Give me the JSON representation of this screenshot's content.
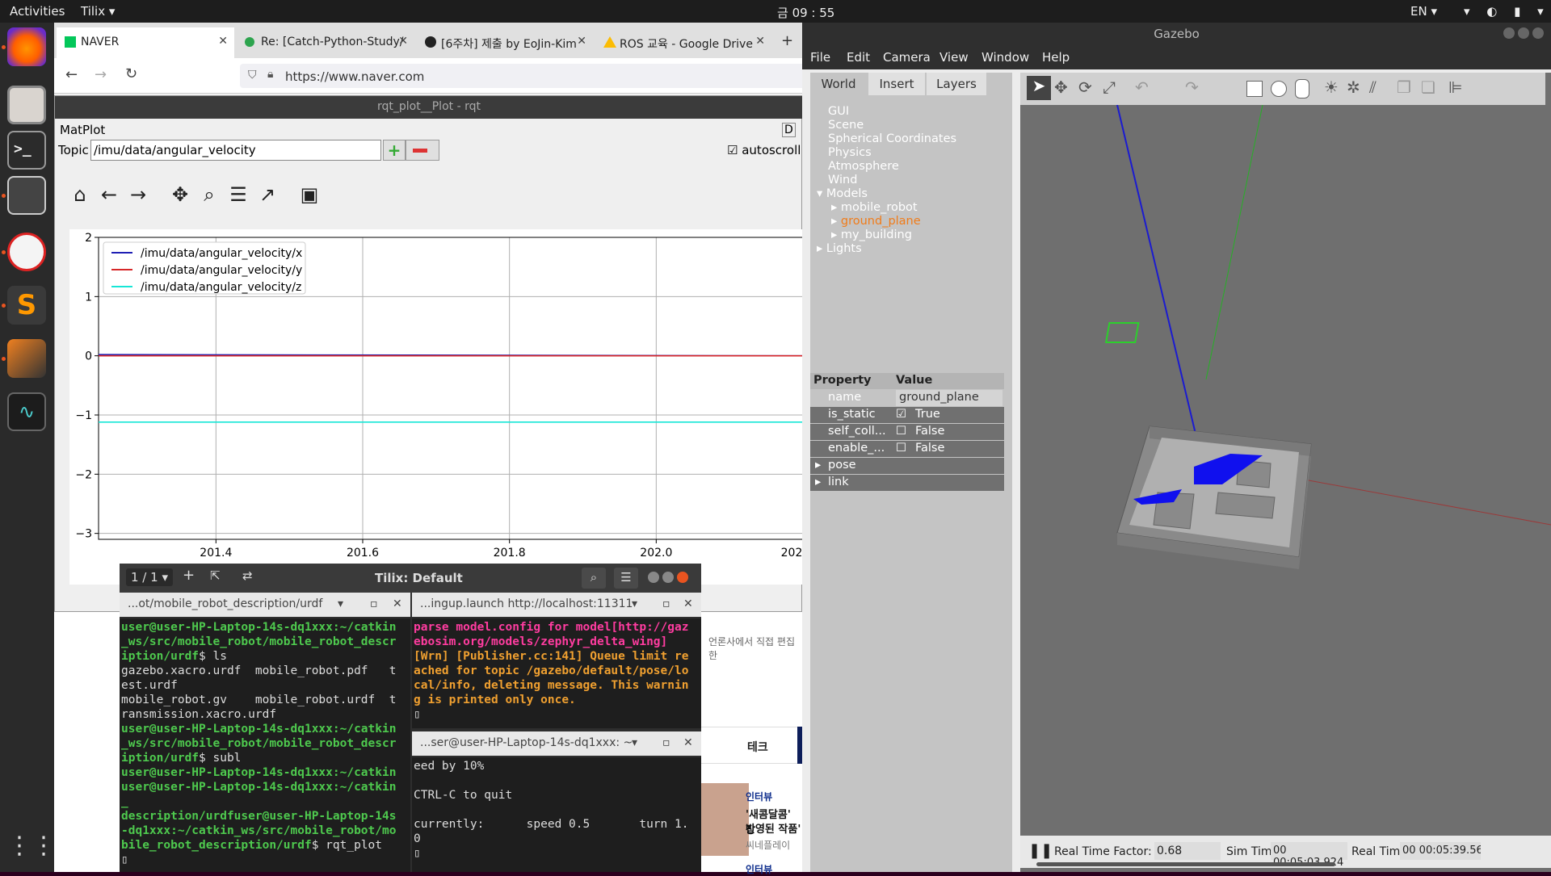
{
  "topbar": {
    "activities": "Activities",
    "app_name": "Tilix ▾",
    "clock": "금 09 : 55",
    "lang": "EN ▾",
    "sys_icons": "▾ ◐ ▮ ▾"
  },
  "browser": {
    "tabs": [
      {
        "label": "NAVER"
      },
      {
        "label": "Re: [Catch-Python-Study/"
      },
      {
        "label": "[6주차] 제출 by EoJin-Kim"
      },
      {
        "label": "ROS 교육 - Google Drive"
      }
    ],
    "url": "https://www.naver.com",
    "bg_texts": {
      "korean_line": "언론사에서 직접 편집한",
      "tech": "테크",
      "interview1": "인터뷰",
      "headline1": "'새콤달콤' 장",
      "headline2": "반영된 작품'",
      "source": "씨네플레이",
      "interview2": "인터뷰"
    }
  },
  "rqt": {
    "window_title": "rqt_plot__Plot - rqt",
    "panel_title": "MatPlot",
    "panel_badge": "D",
    "topic_label": "Topic",
    "topic_value": "/imu/data/angular_velocity",
    "add_symbol": "+",
    "autoscroll_label": "autoscroll",
    "autoscroll_checked": true
  },
  "chart_data": {
    "type": "line",
    "title": "",
    "xlabel": "",
    "ylabel": "",
    "xlim": [
      201.24,
      202.2
    ],
    "ylim": [
      -3.1,
      2
    ],
    "x_ticks": [
      {
        "v": 201.4,
        "label": "201.4"
      },
      {
        "v": 201.6,
        "label": "201.6"
      },
      {
        "v": 201.8,
        "label": "201.8"
      },
      {
        "v": 202.0,
        "label": "202.0"
      },
      {
        "v": 202.2,
        "label": "202"
      }
    ],
    "y_ticks": [
      {
        "v": 2,
        "label": "2"
      },
      {
        "v": 1,
        "label": "1"
      },
      {
        "v": 0,
        "label": "0"
      },
      {
        "v": -1,
        "label": "−1"
      },
      {
        "v": -2,
        "label": "−2"
      },
      {
        "v": -3,
        "label": "−3"
      }
    ],
    "grid": true,
    "legend_position": "top-left",
    "series": [
      {
        "name": "/imu/data/angular_velocity/x",
        "color": "#1f1fb4",
        "x": [
          201.24,
          202.2
        ],
        "values": [
          0.02,
          0.0
        ]
      },
      {
        "name": "/imu/data/angular_velocity/y",
        "color": "#d62728",
        "x": [
          201.24,
          202.2
        ],
        "values": [
          0.0,
          0.0
        ]
      },
      {
        "name": "/imu/data/angular_velocity/z",
        "color": "#17e6d6",
        "x": [
          201.24,
          202.2
        ],
        "values": [
          -1.12,
          -1.12
        ]
      }
    ]
  },
  "tilix": {
    "title": "Tilix: Default",
    "session": "1 / 1 ▾",
    "pane1_title": "...ot/mobile_robot_description/urdf",
    "pane2_title": "...ingup.launch http://localhost:11311",
    "pane3_title": "...ser@user-HP-Laptop-14s-dq1xxx: ~",
    "pane1_lines": [
      {
        "cls": "green",
        "text": "user@user-HP-Laptop-14s-dq1xxx:~/catkin"
      },
      {
        "cls": "green",
        "text": "_ws/src/mobile_robot/mobile_robot_descr"
      },
      {
        "cls": "mix",
        "text": "iption/urdf",
        "rest": "$ ls"
      },
      {
        "cls": "",
        "text": "gazebo.xacro.urdf  mobile_robot.pdf   t"
      },
      {
        "cls": "",
        "text": "est.urdf"
      },
      {
        "cls": "",
        "text": "mobile_robot.gv    mobile_robot.urdf  t"
      },
      {
        "cls": "",
        "text": "ransmission.xacro.urdf"
      },
      {
        "cls": "green",
        "text": "user@user-HP-Laptop-14s-dq1xxx:~/catkin"
      },
      {
        "cls": "green",
        "text": "_ws/src/mobile_robot/mobile_robot_descr"
      },
      {
        "cls": "mix",
        "text": "iption/urdf",
        "rest": "$ subl"
      },
      {
        "cls": "green",
        "text": "user@user-HP-Laptop-14s-dq1xxx:~/catkin"
      },
      {
        "cls": "green",
        "text": "user@user-HP-Laptop-14s-dq1xxx:~/catkin"
      },
      {
        "cls": "green",
        "text": "_"
      },
      {
        "cls": "green",
        "text": "description/urdfuser@user-HP-Laptop-14s"
      },
      {
        "cls": "green",
        "text": "-dq1xxx:~/catkin_ws/src/mobile_robot/mo"
      },
      {
        "cls": "mix",
        "text": "bile_robot_description/urdf",
        "rest": "$ rqt_plot"
      },
      {
        "cls": "",
        "text": "▯"
      }
    ],
    "pane2_lines": [
      {
        "cls": "pink",
        "text": "parse model.config for model[http://gaz"
      },
      {
        "cls": "pink",
        "text": "ebosim.org/models/zephyr_delta_wing]"
      },
      {
        "cls": "orange",
        "text": "[Wrn] [Publisher.cc:141] Queue limit re"
      },
      {
        "cls": "orange",
        "text": "ached for topic /gazebo/default/pose/lo"
      },
      {
        "cls": "orange",
        "text": "cal/info, deleting message. This warnin"
      },
      {
        "cls": "orange",
        "text": "g is printed only once."
      },
      {
        "cls": "",
        "text": "▯"
      }
    ],
    "pane3_lines": [
      {
        "cls": "",
        "text": "eed by 10%"
      },
      {
        "cls": "",
        "text": ""
      },
      {
        "cls": "",
        "text": "CTRL-C to quit"
      },
      {
        "cls": "",
        "text": ""
      },
      {
        "cls": "",
        "text": "currently:      speed 0.5       turn 1."
      },
      {
        "cls": "",
        "text": "0"
      },
      {
        "cls": "",
        "text": "▯"
      }
    ]
  },
  "gazebo": {
    "title": "Gazebo",
    "menu": [
      "File",
      "Edit",
      "Camera",
      "View",
      "Window",
      "Help"
    ],
    "tabs": [
      "World",
      "Insert",
      "Layers"
    ],
    "tree": [
      "GUI",
      "Scene",
      "Spherical Coordinates",
      "Physics",
      "Atmosphere",
      "Wind"
    ],
    "models_label": "Models",
    "models": [
      {
        "name": "mobile_robot",
        "selected": false
      },
      {
        "name": "ground_plane",
        "selected": true
      },
      {
        "name": "my_building",
        "selected": false
      }
    ],
    "lights_label": "Lights",
    "property_header": "Property",
    "value_header": "Value",
    "props": [
      {
        "name": "name",
        "value": "ground_plane",
        "check": null
      },
      {
        "name": "is_static",
        "value": "True",
        "check": true
      },
      {
        "name": "self_coll...",
        "value": "False",
        "check": false
      },
      {
        "name": "enable_...",
        "value": "False",
        "check": false
      }
    ],
    "expandable": [
      "pose",
      "link"
    ],
    "status": {
      "rtf_label": "Real Time Factor:",
      "rtf_value": "0.68",
      "sim_label": "Sim Time:",
      "sim_value": "00 00:05:03.924",
      "real_label": "Real Time:",
      "real_value": "00 00:05:39.56"
    },
    "colors": {
      "selected": "#f07c1a",
      "bg_view": "#6f6f6f",
      "model": "#a0a0a0",
      "robot": "#1010ee"
    }
  }
}
